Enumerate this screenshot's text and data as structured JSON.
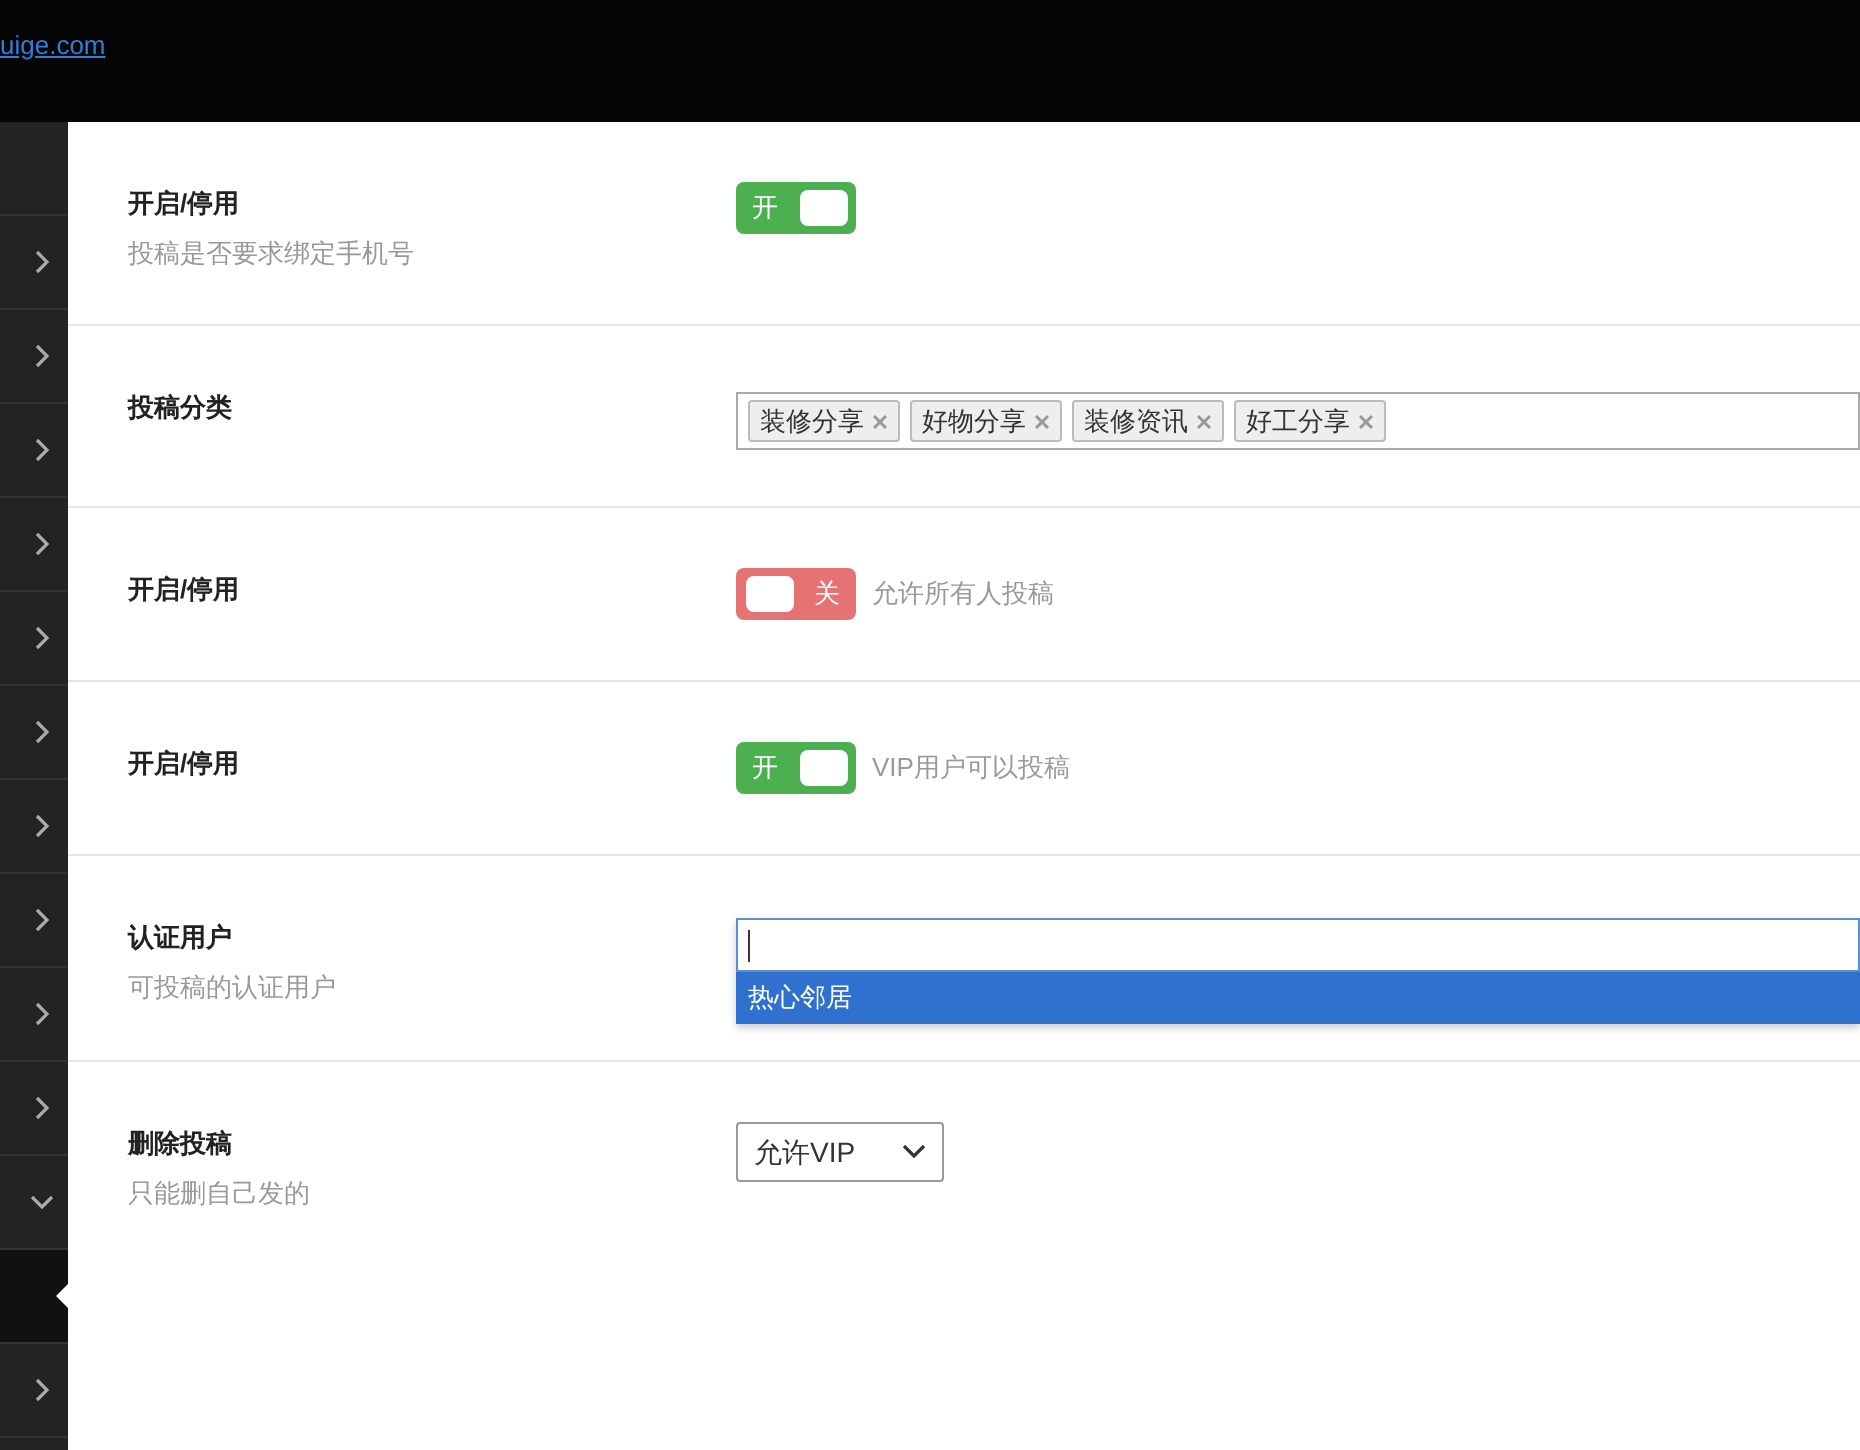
{
  "header": {
    "link": "uige.com"
  },
  "sidebar": {
    "items": [
      {
        "expanded": false,
        "selected": false
      },
      {
        "expanded": false,
        "selected": false
      },
      {
        "expanded": false,
        "selected": false
      },
      {
        "expanded": false,
        "selected": false
      },
      {
        "expanded": false,
        "selected": false
      },
      {
        "expanded": false,
        "selected": false
      },
      {
        "expanded": false,
        "selected": false
      },
      {
        "expanded": false,
        "selected": false
      },
      {
        "expanded": false,
        "selected": false
      },
      {
        "expanded": false,
        "selected": false
      },
      {
        "expanded": true,
        "selected": false
      },
      {
        "selected": true
      },
      {
        "expanded": false,
        "selected": false
      }
    ]
  },
  "settings": [
    {
      "kind": "toggle",
      "label": "开启/停用",
      "description": "投稿是否要求绑定手机号",
      "on": true,
      "toggle_text": "开"
    },
    {
      "kind": "tags",
      "label": "投稿分类",
      "tags": [
        "装修分享",
        "好物分享",
        "装修资讯",
        "好工分享"
      ]
    },
    {
      "kind": "toggle",
      "label": "开启/停用",
      "on": false,
      "toggle_text": "关",
      "hint": "允许所有人投稿"
    },
    {
      "kind": "toggle",
      "label": "开启/停用",
      "on": true,
      "toggle_text": "开",
      "hint": "VIP用户可以投稿"
    },
    {
      "kind": "autocomplete",
      "label": "认证用户",
      "description": "可投稿的认证用户",
      "suggestions": [
        {
          "text": "热心邻居",
          "selected": true
        }
      ]
    },
    {
      "kind": "select",
      "label": "删除投稿",
      "description": "只能删自己发的",
      "value": "允许VIP"
    }
  ]
}
